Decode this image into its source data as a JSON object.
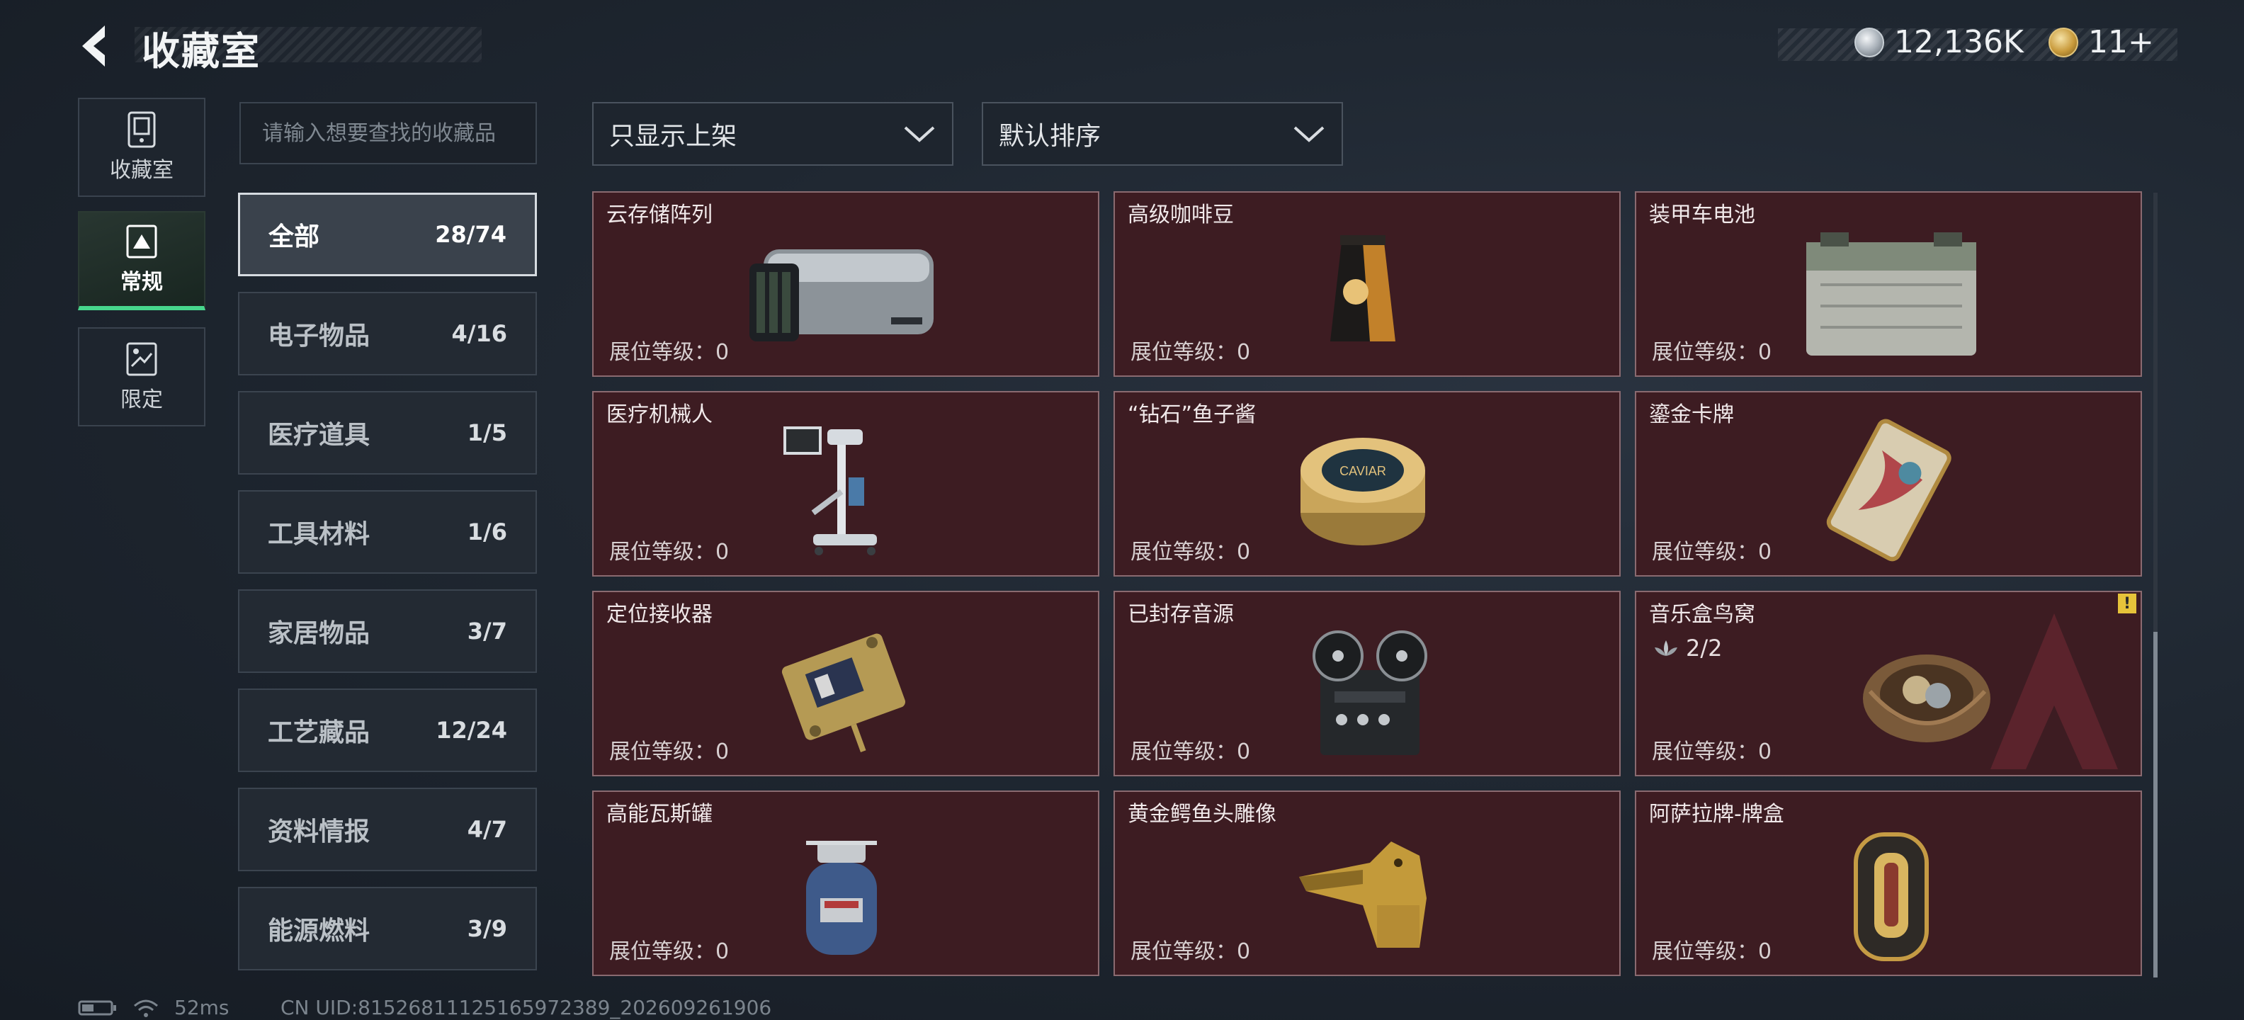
{
  "header": {
    "title": "收藏室",
    "currencies": [
      {
        "icon": "silver-coin-icon",
        "value": "12,136K"
      },
      {
        "icon": "gold-triangle-coin-icon",
        "value": "11+"
      }
    ]
  },
  "rail": [
    {
      "icon": "collection-room-icon",
      "label": "收藏室",
      "active": false
    },
    {
      "icon": "regular-icon",
      "label": "常规",
      "active": true
    },
    {
      "icon": "limited-icon",
      "label": "限定",
      "active": false
    }
  ],
  "search": {
    "placeholder": "请输入想要查找的收藏品"
  },
  "categories": [
    {
      "name": "全部",
      "count": "28/74",
      "active": true
    },
    {
      "name": "电子物品",
      "count": "4/16"
    },
    {
      "name": "医疗道具",
      "count": "1/5"
    },
    {
      "name": "工具材料",
      "count": "1/6"
    },
    {
      "name": "家居物品",
      "count": "3/7"
    },
    {
      "name": "工艺藏品",
      "count": "12/24"
    },
    {
      "name": "资料情报",
      "count": "4/7"
    },
    {
      "name": "能源燃料",
      "count": "3/9"
    }
  ],
  "filters": {
    "show": "只显示上架",
    "sort": "默认排序"
  },
  "items": [
    {
      "name": "云存储阵列",
      "level": "展位等级：0",
      "icon": "cloud-storage-array-icon"
    },
    {
      "name": "高级咖啡豆",
      "level": "展位等级：0",
      "icon": "coffee-bean-bag-icon"
    },
    {
      "name": "装甲车电池",
      "level": "展位等级：0",
      "icon": "armored-vehicle-battery-icon"
    },
    {
      "name": "医疗机械人",
      "level": "展位等级：0",
      "icon": "medical-robot-icon"
    },
    {
      "name": "“钻石”鱼子酱",
      "level": "展位等级：0",
      "icon": "caviar-tin-icon",
      "tin_text": "CAVIAR"
    },
    {
      "name": "鎏金卡牌",
      "level": "展位等级：0",
      "icon": "gilded-card-icon"
    },
    {
      "name": "定位接收器",
      "level": "展位等级：0",
      "icon": "gps-receiver-icon"
    },
    {
      "name": "已封存音源",
      "level": "展位等级：0",
      "icon": "reel-to-reel-recorder-icon"
    },
    {
      "name": "音乐盒鸟窝",
      "level": "展位等级：0",
      "icon": "bird-nest-music-box-icon",
      "extra": "2/2",
      "warning": "!"
    },
    {
      "name": "高能瓦斯罐",
      "level": "展位等级：0",
      "icon": "gas-canister-icon"
    },
    {
      "name": "黄金鳄鱼头雕像",
      "level": "展位等级：0",
      "icon": "golden-crocodile-statue-icon"
    },
    {
      "name": "阿萨拉牌-牌盒",
      "level": "展位等级：0",
      "icon": "card-box-icon"
    }
  ],
  "status": {
    "ping": "52ms",
    "uid": "CN UID:815268111251659723​89_202609261906"
  }
}
